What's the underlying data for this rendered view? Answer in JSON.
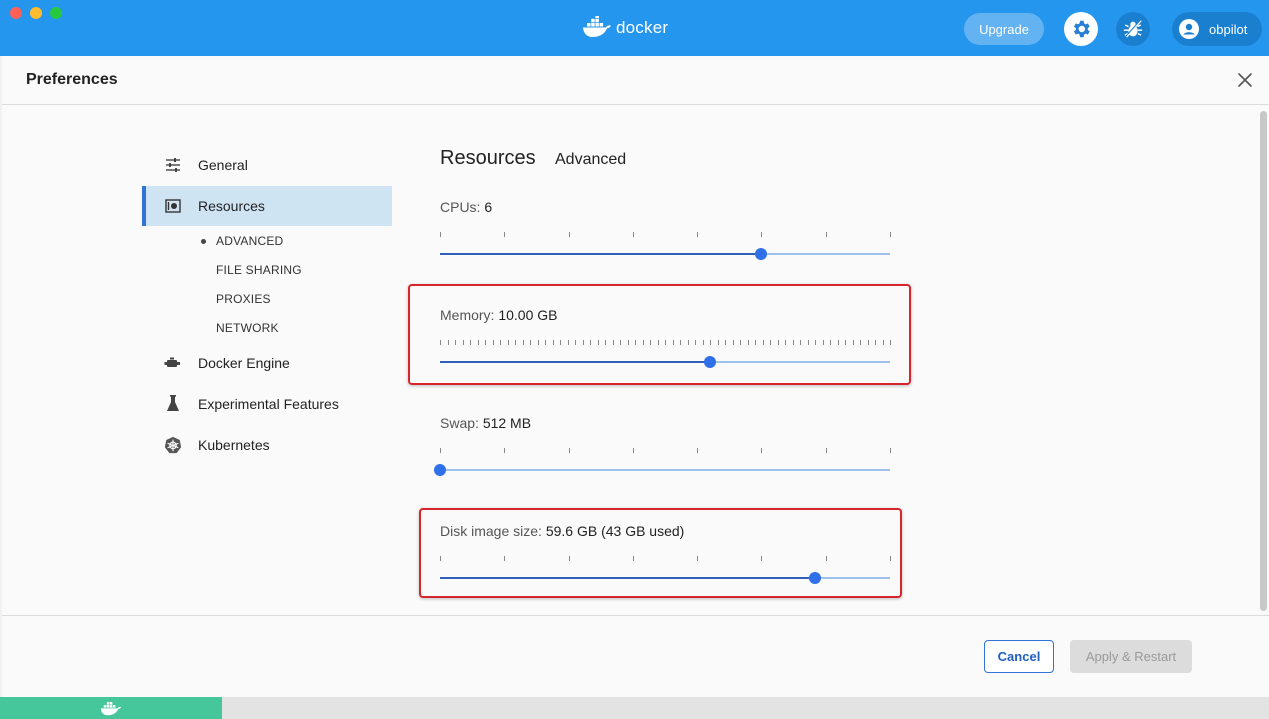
{
  "app": {
    "brand": "docker",
    "upgrade_label": "Upgrade",
    "user_name": "obpilot",
    "colors": {
      "topbar": "#2496ed",
      "accent": "#2f6fe8",
      "highlight": "#d6262c",
      "status_green": "#46c79b"
    }
  },
  "dialog": {
    "title": "Preferences"
  },
  "sidebar": {
    "items": [
      {
        "label": "General",
        "icon": "sliders-icon"
      },
      {
        "label": "Resources",
        "icon": "resources-icon",
        "active": true
      },
      {
        "label": "Docker Engine",
        "icon": "engine-icon"
      },
      {
        "label": "Experimental Features",
        "icon": "flask-icon"
      },
      {
        "label": "Kubernetes",
        "icon": "kubernetes-icon"
      }
    ],
    "sub_items": [
      {
        "label": "ADVANCED",
        "active": true
      },
      {
        "label": "FILE SHARING"
      },
      {
        "label": "PROXIES"
      },
      {
        "label": "NETWORK"
      }
    ]
  },
  "main": {
    "title": "Resources",
    "subtitle": "Advanced",
    "cpus": {
      "label": "CPUs:",
      "value": "6",
      "fraction": 0.714
    },
    "memory": {
      "label": "Memory:",
      "value": "10.00 GB",
      "fraction": 0.6
    },
    "swap": {
      "label": "Swap:",
      "value": "512 MB",
      "fraction": 0.0
    },
    "disk": {
      "label": "Disk image size:",
      "value": "59.6 GB (43 GB used)",
      "fraction": 0.833
    }
  },
  "footer": {
    "cancel_label": "Cancel",
    "apply_label": "Apply & Restart"
  }
}
